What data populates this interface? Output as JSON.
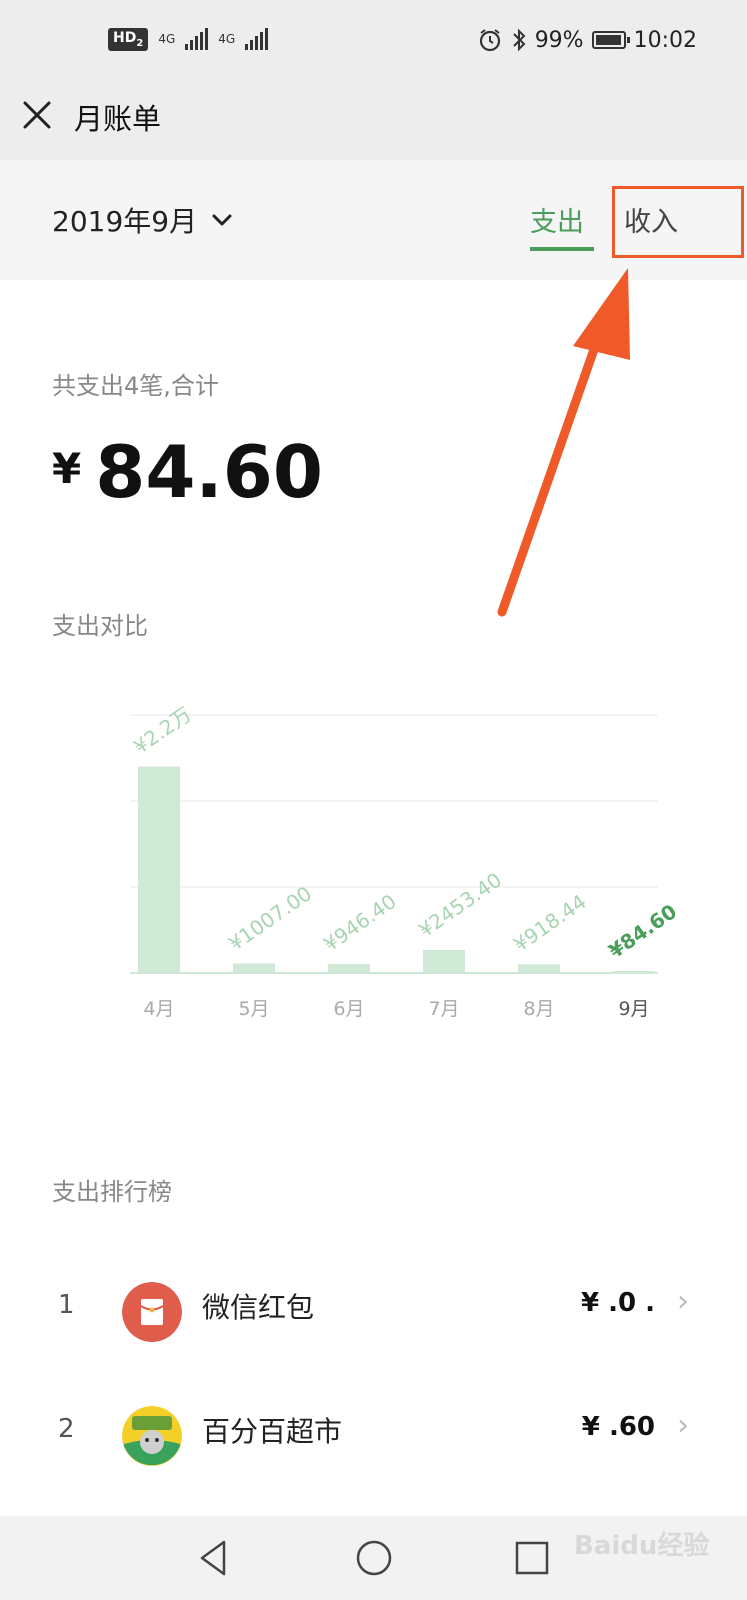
{
  "status_bar": {
    "hd_label": "HD",
    "hd_sub": "2",
    "net1": "4G",
    "net2": "4G",
    "battery": "99%",
    "battery_level": 0.99,
    "time": "10:02"
  },
  "header": {
    "title": "月账单"
  },
  "filter": {
    "month": "2019年9月",
    "tab_expense": "支出",
    "tab_income": "收入",
    "active_tab": "支出"
  },
  "summary": {
    "caption": "共支出4笔,合计",
    "currency": "¥",
    "amount": "84.60"
  },
  "comparison": {
    "title": "支出对比"
  },
  "chart_data": {
    "type": "bar",
    "categories": [
      "4月",
      "5月",
      "6月",
      "7月",
      "8月",
      "9月"
    ],
    "values": [
      22000,
      1007.0,
      946.4,
      2453.4,
      918.44,
      84.6
    ],
    "data_labels": [
      "¥2.2万",
      "¥1007.00",
      "¥946.40",
      "¥2453.40",
      "¥918.44",
      "¥84.60"
    ],
    "highlight_index": 5,
    "colors": {
      "bar": "#cfe9d6",
      "label": "#a7d4b2",
      "highlight_label": "#4a9d5b",
      "grid": "#f0f0f0"
    },
    "ylim": [
      0,
      27500
    ],
    "grid": true
  },
  "ranking": {
    "title": "支出排行榜",
    "items": [
      {
        "rank": "1",
        "name": "微信红包",
        "amount": "¥ .0  .",
        "icon": "red-packet-icon",
        "icon_color": "#e05c4b"
      },
      {
        "rank": "2",
        "name": "百分百超市",
        "amount": "¥ .60",
        "icon": "store-logo-icon",
        "icon_color": "#f3cf28"
      }
    ]
  },
  "watermark": "Baidu经验"
}
